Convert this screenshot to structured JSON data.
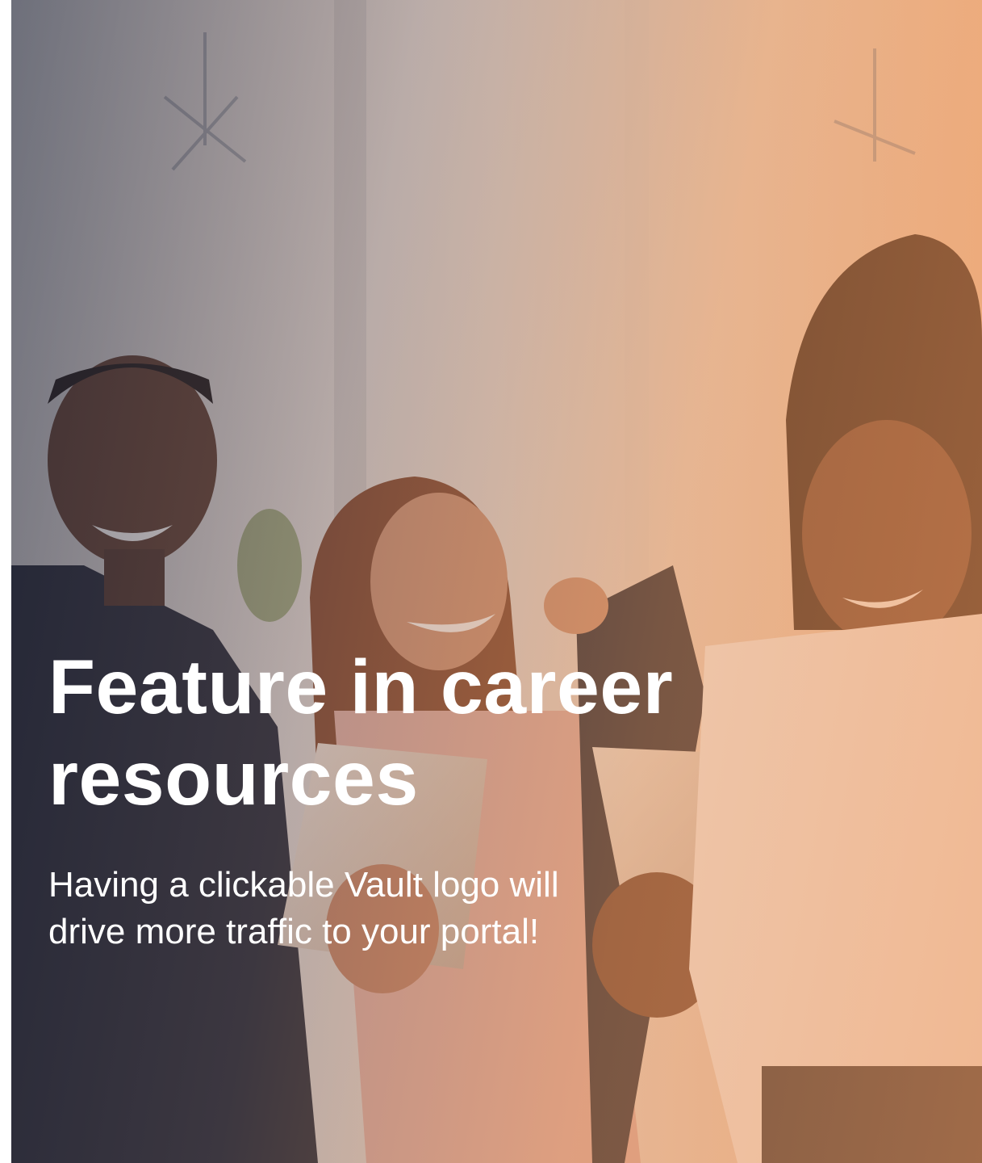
{
  "hero": {
    "image": "photo of three smiling professionals holding tablets",
    "overlay_colors": [
      "#222a3e",
      "#e8965f"
    ],
    "title": "Feature in career resources",
    "subtitle": "Having a clickable Vault logo will drive more traffic to your portal!"
  }
}
